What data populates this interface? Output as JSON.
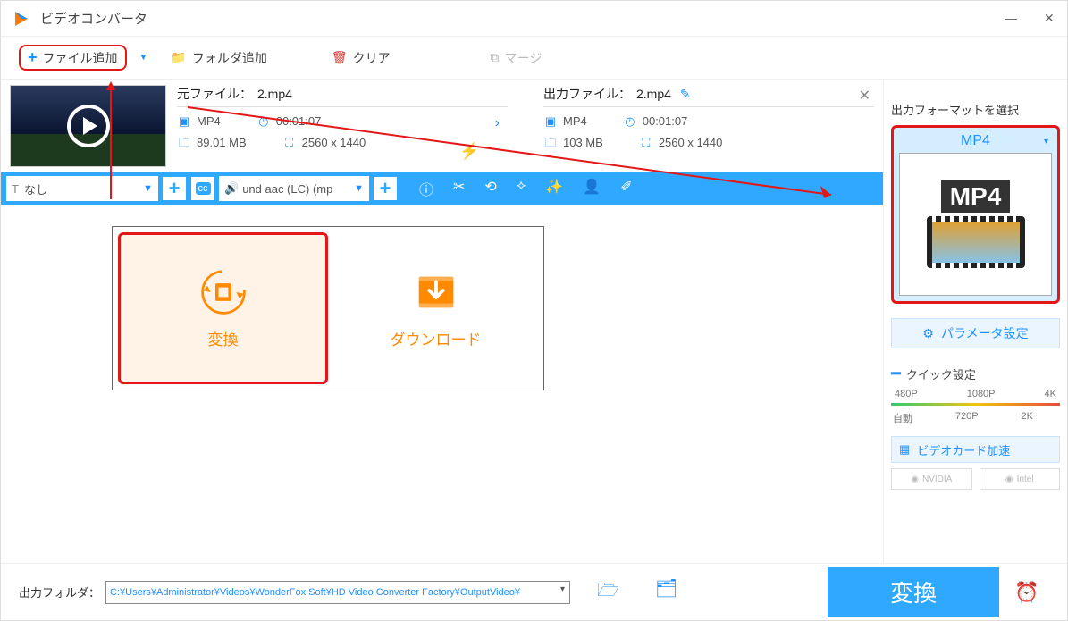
{
  "app": {
    "title": "ビデオコンバータ"
  },
  "toolbar": {
    "add_file": "ファイル追加",
    "add_folder": "フォルダ追加",
    "clear": "クリア",
    "merge": "マージ"
  },
  "item": {
    "source_label": "元ファイル：",
    "source_name": "2.mp4",
    "output_label": "出力ファイル：",
    "output_name": "2.mp4",
    "src_format": "MP4",
    "src_duration": "00:01:07",
    "src_size": "89.01 MB",
    "src_resolution": "2560 x 1440",
    "out_format": "MP4",
    "out_duration": "00:01:07",
    "out_size": "103 MB",
    "out_resolution": "2560 x 1440"
  },
  "bluebar": {
    "subtitle_sel": "なし",
    "audio_sel": "und aac (LC) (mp"
  },
  "cards": {
    "convert": "変換",
    "download": "ダウンロード"
  },
  "side": {
    "choose_format": "出力フォーマットを選択",
    "fmt_label": "MP4",
    "fmt_badge": "MP4",
    "param_btn": "パラメータ設定",
    "quick_title": "クイック設定",
    "q_480": "480P",
    "q_1080": "1080P",
    "q_4k": "4K",
    "q_auto": "自動",
    "q_720": "720P",
    "q_2k": "2K",
    "gpu_btn": "ビデオカード加速",
    "nvidia": "NVIDIA",
    "intel": "Intel"
  },
  "bottom": {
    "out_folder_lbl": "出力フォルダ：",
    "out_folder_val": "C:¥Users¥Administrator¥Videos¥WonderFox Soft¥HD Video Converter Factory¥OutputVideo¥",
    "convert": "変換"
  }
}
